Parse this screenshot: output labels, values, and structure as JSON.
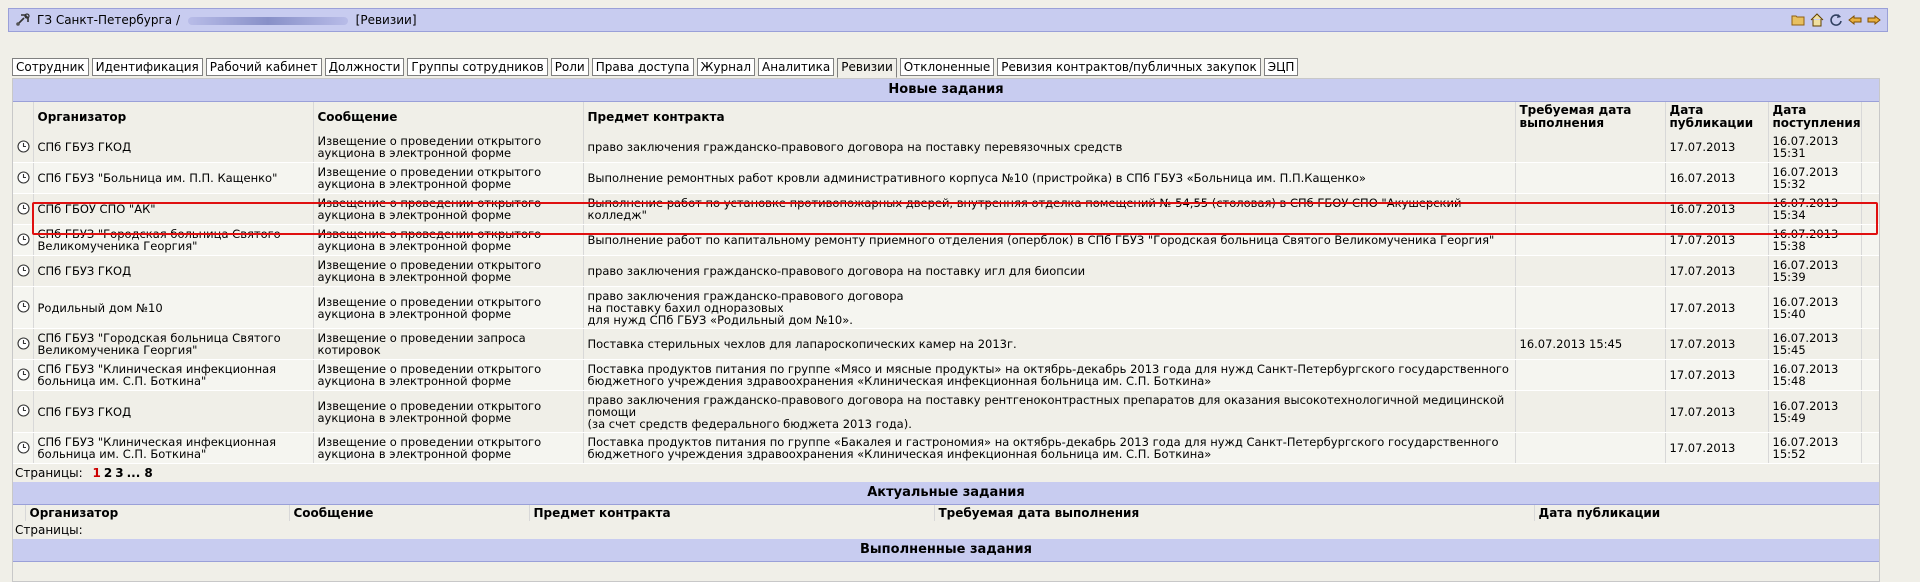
{
  "title": {
    "prefix": "ГЗ Санкт-Петербурга /",
    "suffix": "[Ревизии]"
  },
  "toolbar_icons": [
    "folder-icon",
    "home-icon",
    "refresh-icon",
    "back-arrow-icon",
    "forward-arrow-icon"
  ],
  "tabs": [
    {
      "label": "Сотрудник"
    },
    {
      "label": "Идентификация"
    },
    {
      "label": "Рабочий кабинет"
    },
    {
      "label": "Должности"
    },
    {
      "label": "Группы сотрудников"
    },
    {
      "label": "Роли"
    },
    {
      "label": "Права доступа"
    },
    {
      "label": "Журнал"
    },
    {
      "label": "Аналитика"
    },
    {
      "label": "Ревизии",
      "active": true
    },
    {
      "label": "Отклоненные"
    },
    {
      "label": "Ревизия контрактов/публичных закупок"
    },
    {
      "label": "ЭЦП"
    }
  ],
  "new_tasks": {
    "title": "Новые задания",
    "columns": [
      "Организатор",
      "Сообщение",
      "Предмет контракта",
      "Требуемая дата выполнения",
      "Дата публикации",
      "Дата поступления"
    ],
    "rows": [
      {
        "org": "СПб ГБУЗ ГКОД",
        "msg": "Извещение о проведении открытого аукциона в электронной форме",
        "subject": "право заключения гражданско-правового договора на поставку перевязочных средств",
        "req_date": "",
        "pub_date": "17.07.2013",
        "recv_date": "16.07.2013 15:31"
      },
      {
        "org": "СПб ГБУЗ \"Больница им. П.П. Кащенко\"",
        "msg": "Извещение о проведении открытого аукциона в электронной форме",
        "subject": "Выполнение ремонтных работ кровли административного корпуса №10 (пристройка) в СПб ГБУЗ «Больница им. П.П.Кащенко»",
        "req_date": "",
        "pub_date": "16.07.2013",
        "recv_date": "16.07.2013 15:32"
      },
      {
        "org": "СПб ГБОУ СПО \"АК\"",
        "msg": "Извещение о проведении открытого аукциона в электронной форме",
        "subject": "Выполнение работ по установке противопожарных дверей, внутренняя отделка помещений № 54,55 (столовая) в СПб ГБОУ СПО \"Акушерский колледж\"",
        "req_date": "",
        "pub_date": "16.07.2013",
        "recv_date": "16.07.2013 15:34"
      },
      {
        "org": "СПб ГБУЗ \"Городская больница Святого Великомученика Георгия\"",
        "msg": "Извещение о проведении открытого аукциона в электронной форме",
        "subject": "Выполнение работ по капитальному ремонту приемного отделения (оперблок) в СПб ГБУЗ \"Городская больница Святого Великомученика Георгия\"",
        "req_date": "",
        "pub_date": "17.07.2013",
        "recv_date": "16.07.2013 15:38"
      },
      {
        "org": "СПб ГБУЗ ГКОД",
        "msg": "Извещение о проведении открытого аукциона в электронной форме",
        "subject": "право заключения гражданско-правового договора на поставку игл для биопсии",
        "req_date": "",
        "pub_date": "17.07.2013",
        "recv_date": "16.07.2013 15:39"
      },
      {
        "org": "Родильный дом №10",
        "msg": "Извещение о проведении открытого аукциона в электронной форме",
        "subject": "право заключения гражданско-правового договора\nна поставку бахил одноразовых\nдля нужд СПб ГБУЗ «Родильный дом №10».",
        "req_date": "",
        "pub_date": "17.07.2013",
        "recv_date": "16.07.2013 15:40",
        "tall": true
      },
      {
        "org": "СПб ГБУЗ \"Городская больница Святого Великомученика Георгия\"",
        "msg": "Извещение о проведении запроса котировок",
        "subject": "Поставка стерильных чехлов для лапароскопических камер на 2013г.",
        "req_date": "16.07.2013 15:45",
        "pub_date": "17.07.2013",
        "recv_date": "16.07.2013 15:45"
      },
      {
        "org": "СПб ГБУЗ \"Клиническая инфекционная больница им. С.П. Боткина\"",
        "msg": "Извещение о проведении открытого аукциона в электронной форме",
        "subject": "Поставка продуктов питания по группе «Мясо и мясные продукты» на октябрь-декабрь 2013 года для нужд Санкт-Петербургского государственного бюджетного учреждения здравоохранения «Клиническая инфекционная больница им. С.П. Боткина»",
        "req_date": "",
        "pub_date": "17.07.2013",
        "recv_date": "16.07.2013 15:48"
      },
      {
        "org": "СПб ГБУЗ ГКОД",
        "msg": "Извещение о проведении открытого аукциона в электронной форме",
        "subject": "право заключения гражданско-правового договора на поставку рентгеноконтрастных препаратов для оказания высокотехнологичной медицинской помощи\n(за счет средств федерального бюджета 2013 года).",
        "req_date": "",
        "pub_date": "17.07.2013",
        "recv_date": "16.07.2013 15:49",
        "tall": true
      },
      {
        "org": "СПб ГБУЗ \"Клиническая инфекционная больница им. С.П. Боткина\"",
        "msg": "Извещение о проведении открытого аукциона в электронной форме",
        "subject": "Поставка продуктов питания по группе «Бакалея и гастрономия» на октябрь-декабрь 2013 года для нужд Санкт-Петербургского государственного бюджетного учреждения здравоохранения «Клиническая инфекционная больница им. С.П. Боткина»",
        "req_date": "",
        "pub_date": "17.07.2013",
        "recv_date": "16.07.2013 15:52"
      }
    ]
  },
  "pager": {
    "label": "Страницы:",
    "pages": [
      "1",
      "2",
      "3",
      "... 8"
    ],
    "current": "1"
  },
  "actual_tasks": {
    "title": "Актуальные задания",
    "columns": [
      "Организатор",
      "Сообщение",
      "Предмет контракта",
      "Требуемая дата выполнения",
      "Дата публикации"
    ],
    "pager_label": "Страницы:"
  },
  "done_tasks": {
    "title": "Выполненные задания"
  }
}
